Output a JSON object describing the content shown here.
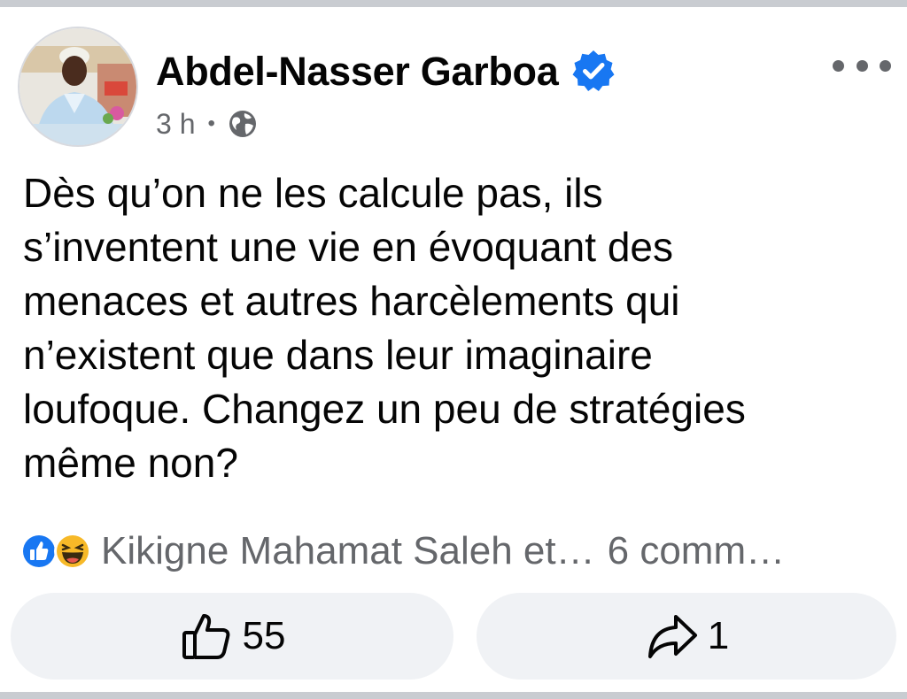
{
  "post": {
    "author": "Abdel-Nasser Garboa",
    "time": "3 h",
    "separator": "•",
    "text": "Dès qu’on ne les calcule pas, ils\ns’inventent une vie en évoquant des\nmenaces et autres harcèlements qui\nn’existent que dans leur imaginaire\nloufoque. Changez un peu de stratégies\nmême non?"
  },
  "reactions": {
    "reactors": "Kikigne Mahamat Saleh et…",
    "comments": "6 comm…"
  },
  "actions": {
    "like_count": "55",
    "share_count": "1"
  },
  "icons": {
    "verified": "verified-badge-icon",
    "audience": "globe-icon",
    "menu": "more-options-icon",
    "like": "thumbs-up-icon",
    "share": "share-arrow-icon"
  },
  "colors": {
    "accent": "#1877f2",
    "secondary_text": "#65676b",
    "button_bg": "#f0f2f5",
    "haha_yellow": "#f7b928"
  }
}
